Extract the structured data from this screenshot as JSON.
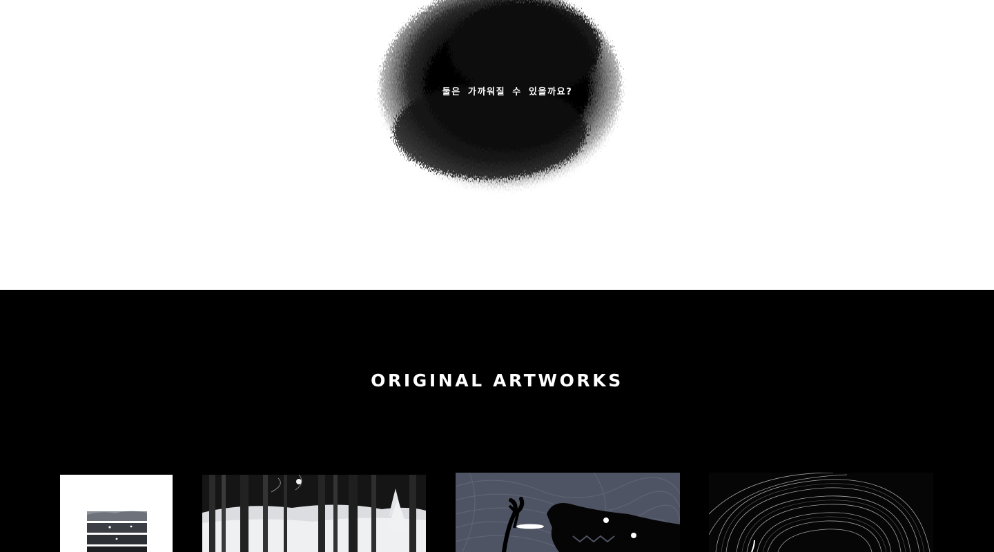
{
  "hero": {
    "caption": "둘은 가까워질 수 있을까요?"
  },
  "artworks": {
    "title": "ORIGINAL ARTWORKS",
    "items": [
      {
        "icon": "layered-landscape-artwork"
      },
      {
        "icon": "snowy-forest-artwork"
      },
      {
        "icon": "dark-creature-artwork"
      },
      {
        "icon": "swirl-vortex-artwork"
      }
    ]
  },
  "colors": {
    "page_background": "#ffffff",
    "section_background": "#000000",
    "title_text": "#ffffff",
    "ink": "#000000",
    "creature_background": "#4e5463"
  }
}
